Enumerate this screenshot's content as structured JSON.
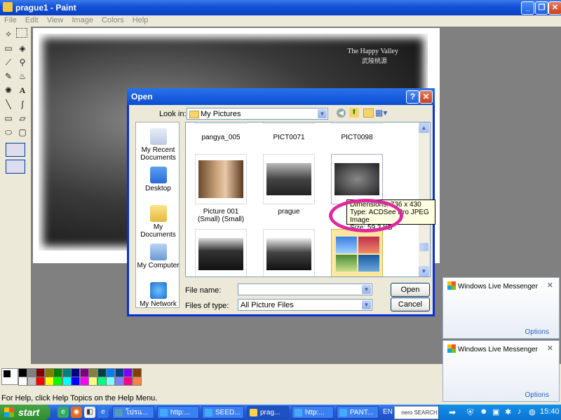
{
  "window": {
    "title": "prague1 - Paint",
    "minimize": "_",
    "maximize": "❐",
    "close": "✕"
  },
  "menu": [
    "File",
    "Edit",
    "View",
    "Image",
    "Colors",
    "Help"
  ],
  "canvas": {
    "caption_en": "The Happy Valley",
    "caption_cn": "武陵桃源"
  },
  "status": "For Help, click Help Topics on the Help Menu.",
  "palette": [
    "#000000",
    "#808080",
    "#800000",
    "#808000",
    "#008000",
    "#008080",
    "#000080",
    "#800080",
    "#808040",
    "#004040",
    "#0080ff",
    "#004080",
    "#8000ff",
    "#804000",
    "#ffffff",
    "#c0c0c0",
    "#ff0000",
    "#ffff00",
    "#00ff00",
    "#00ffff",
    "#0000ff",
    "#ff00ff",
    "#ffff80",
    "#00ff80",
    "#80ffff",
    "#8080ff",
    "#ff0080",
    "#ff8040"
  ],
  "dialog": {
    "title": "Open",
    "help": "?",
    "close": "✕",
    "look_in_label": "Look in:",
    "look_in_value": "My Pictures",
    "places": [
      "My Recent Documents",
      "Desktop",
      "My Documents",
      "My Computer",
      "My Network"
    ],
    "files": {
      "row1": [
        "pangya_005",
        "PICT0071",
        "PICT0098"
      ],
      "row2": [
        "Picture 001 (Small) (Small)",
        "prague",
        "p"
      ]
    },
    "tooltip": {
      "line1": "Dimensions: 736 x 430",
      "line2": "Type: ACDSee Pro JPEG Image",
      "line3": "Size: 59.3 KB"
    },
    "file_name_label": "File name:",
    "file_name_value": "",
    "file_type_label": "Files of type:",
    "file_type_value": "All Picture Files",
    "open_button": "Open",
    "cancel_button": "Cancel"
  },
  "messenger": [
    {
      "title": "Windows Live Messenger",
      "options": "Options",
      "close": "✕"
    },
    {
      "title": "Windows Live Messenger",
      "options": "Options",
      "close": "✕"
    }
  ],
  "taskbar": {
    "start": "start",
    "tasks": [
      "โปรแ...",
      "http:...",
      "SEED...",
      "prag...",
      "http:...",
      "PANT..."
    ],
    "lang": "EN",
    "search": "nero SEARCH",
    "clock": "15:40"
  }
}
